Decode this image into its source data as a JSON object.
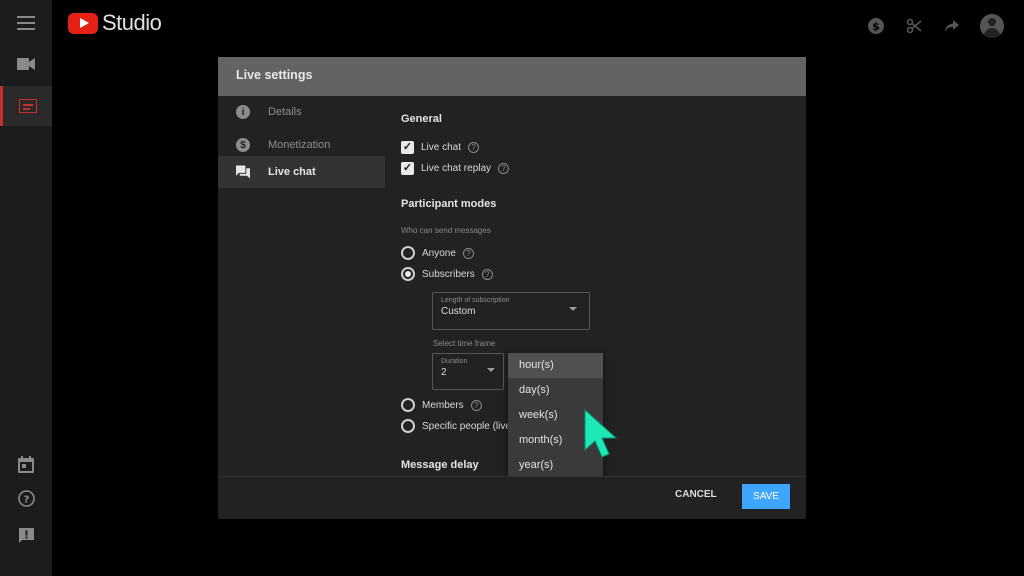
{
  "header": {
    "logo_text": "Studio",
    "icons": [
      "dollar-icon",
      "scissors-icon",
      "share-icon",
      "account-icon"
    ]
  },
  "rail": {
    "top_icons": [
      "menu-icon",
      "video-icon",
      "live-icon"
    ],
    "bottom_icons": [
      "calendar-icon",
      "help-icon",
      "feedback-icon"
    ]
  },
  "dialog": {
    "title": "Live settings",
    "nav": [
      {
        "label": "Details",
        "icon": "info-icon"
      },
      {
        "label": "Monetization",
        "icon": "dollar-icon"
      },
      {
        "label": "Live chat",
        "icon": "chat-icon"
      }
    ],
    "general": {
      "title": "General",
      "live_chat": {
        "label": "Live chat",
        "checked": true
      },
      "live_chat_replay": {
        "label": "Live chat replay",
        "checked": true
      }
    },
    "participant": {
      "title": "Participant modes",
      "hint": "Who can send messages",
      "anyone": "Anyone",
      "subscribers": "Subscribers",
      "subscription_select": {
        "label": "Length of subscription",
        "value": "Custom"
      },
      "time_frame_hint": "Select time frame",
      "duration_select": {
        "label": "Duration",
        "value": "2"
      },
      "members": "Members",
      "specific": "Specific people (live"
    },
    "message_delay": {
      "title": "Message delay"
    },
    "unit_menu": [
      "hour(s)",
      "day(s)",
      "week(s)",
      "month(s)",
      "year(s)"
    ],
    "cancel_label": "CANCEL",
    "save_label": "SAVE"
  },
  "colors": {
    "accent": "#3ea6ff",
    "brand": "#e62117",
    "cursor": "#1de9b6"
  }
}
